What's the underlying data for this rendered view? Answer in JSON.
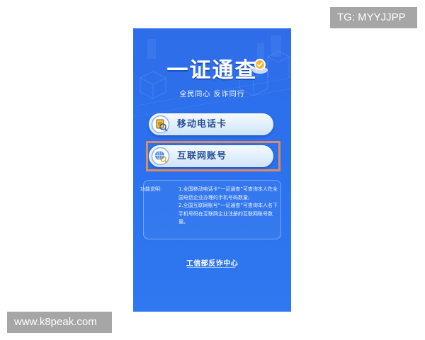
{
  "watermarks": {
    "top_right": "TG: MYYJJPP",
    "bottom_left": "www.k8peak.com"
  },
  "app": {
    "title": "一证通查",
    "slogan": "全民同心  反诈同行",
    "buttons": [
      {
        "label": "移动电话卡",
        "icon": "sim-card-search-icon"
      },
      {
        "label": "互联网账号",
        "icon": "globe-search-icon"
      }
    ],
    "highlighted_button_index": 1,
    "info": {
      "label": "功能说明:",
      "text": "1.全国移动电话卡“一证通查”可查询本人在全国电信企业办理的手机号码数量;\n2.全国互联网账号“一证通查”可查询本人名下手机号码在互联网企业注册的互联网账号数量。"
    },
    "footer": "工信部反诈中心"
  },
  "colors": {
    "screen_bg": "#2f6de8",
    "button_text": "#254e96",
    "highlight_border": "#e08a5e",
    "watermark_bg": "#a6a6a6"
  }
}
